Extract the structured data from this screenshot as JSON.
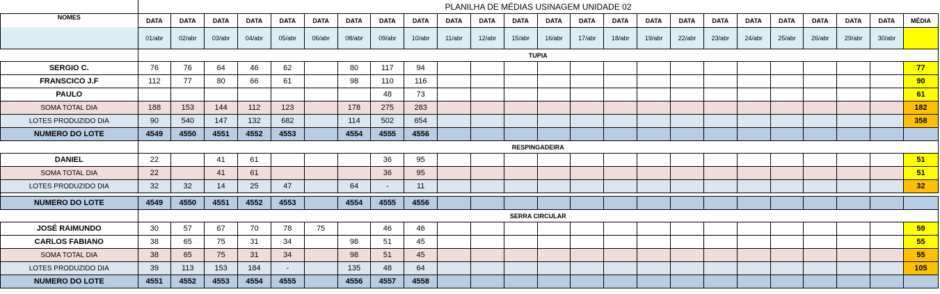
{
  "title": "PLANILHA DE MÉDIAS USINAGEM UNIDADE 02",
  "header": {
    "nomes": "NOMES",
    "data_label": "DATA",
    "media_label": "MÉDIA",
    "dates": [
      "01/abr",
      "02/abr",
      "03/abr",
      "04/abr",
      "05/abr",
      "06/abr",
      "08/abr",
      "09/abr",
      "10/abr",
      "11/abr",
      "12/abr",
      "15/abr",
      "16/abr",
      "17/abr",
      "18/abr",
      "19/abr",
      "22/abr",
      "23/abr",
      "24/abr",
      "25/abr",
      "26/abr",
      "29/abr",
      "30/abr"
    ]
  },
  "sections": [
    {
      "name": "TUPIA",
      "rows": [
        {
          "type": "person",
          "label": "SERGIO C.",
          "values": [
            "76",
            "76",
            "64",
            "46",
            "62",
            "",
            "80",
            "117",
            "94"
          ],
          "media": "77",
          "media_color": "yellow"
        },
        {
          "type": "person",
          "label": "FRANSCICO J.F",
          "values": [
            "112",
            "77",
            "80",
            "66",
            "61",
            "",
            "98",
            "110",
            "116"
          ],
          "media": "90",
          "media_color": "yellow"
        },
        {
          "type": "person",
          "label": "PAULO",
          "values": [
            "",
            "",
            "",
            "",
            "",
            "",
            "",
            "48",
            "73"
          ],
          "media": "61",
          "media_color": "yellow"
        },
        {
          "type": "soma",
          "label": "SOMA TOTAL DIA",
          "values": [
            "188",
            "153",
            "144",
            "112",
            "123",
            "",
            "178",
            "275",
            "283"
          ],
          "media": "182",
          "media_color": "orange"
        },
        {
          "type": "lotes",
          "label": "LOTES PRODUZIDO DIA",
          "values": [
            "90",
            "540",
            "147",
            "132",
            "682",
            "",
            "114",
            "502",
            "654"
          ],
          "media": "358",
          "media_color": "orange"
        },
        {
          "type": "numero",
          "label": "NUMERO DO LOTE",
          "values": [
            "4549",
            "4550",
            "4551",
            "4552",
            "4553",
            "",
            "4554",
            "4555",
            "4556"
          ],
          "media": "",
          "media_color": ""
        }
      ]
    },
    {
      "name": "RESPINGADEIRA",
      "rows": [
        {
          "type": "person",
          "label": "DANIEL",
          "values": [
            "22",
            "",
            "41",
            "61",
            "",
            "",
            "",
            "36",
            "95"
          ],
          "media": "51",
          "media_color": "yellow"
        },
        {
          "type": "soma",
          "label": "SOMA TOTAL DIA",
          "values": [
            "22",
            "",
            "41",
            "61",
            "",
            "",
            "",
            "36",
            "95"
          ],
          "media": "51",
          "media_color": "yellow"
        },
        {
          "type": "lotes",
          "label": "LOTES PRODUZIDO DIA",
          "values": [
            "32",
            "32",
            "14",
            "25",
            "47",
            "",
            "64",
            "-",
            "11"
          ],
          "media": "32",
          "media_color": "orange"
        },
        {
          "type": "gap",
          "label": "",
          "values": [],
          "media": "",
          "media_color": ""
        },
        {
          "type": "numero",
          "label": "NUMERO DO LOTE",
          "values": [
            "4549",
            "4550",
            "4551",
            "4552",
            "4553",
            "",
            "4554",
            "4555",
            "4556"
          ],
          "media": "",
          "media_color": ""
        }
      ]
    },
    {
      "name": "SERRA CIRCULAR",
      "rows": [
        {
          "type": "person",
          "label": "JOSÉ RAIMUNDO",
          "values": [
            "30",
            "57",
            "67",
            "70",
            "78",
            "75",
            "",
            "46",
            "46"
          ],
          "media": "59",
          "media_color": "yellow"
        },
        {
          "type": "person",
          "label": "CARLOS FABIANO",
          "values": [
            "38",
            "65",
            "75",
            "31",
            "34",
            "",
            "98",
            "51",
            "45"
          ],
          "media": "55",
          "media_color": "yellow"
        },
        {
          "type": "soma",
          "label": "SOMA TOTAL DIA",
          "values": [
            "38",
            "65",
            "75",
            "31",
            "34",
            "",
            "98",
            "51",
            "45"
          ],
          "media": "55",
          "media_color": "orange"
        },
        {
          "type": "lotes",
          "label": "LOTES PRODUZIDO DIA",
          "values": [
            "39",
            "113",
            "153",
            "184",
            "-",
            "",
            "135",
            "48",
            "64"
          ],
          "media": "105",
          "media_color": "orange"
        },
        {
          "type": "numero",
          "label": "NUMERO DO LOTE",
          "values": [
            "4551",
            "4552",
            "4553",
            "4554",
            "4555",
            "",
            "4556",
            "4557",
            "4558"
          ],
          "media": "",
          "media_color": ""
        }
      ]
    }
  ]
}
